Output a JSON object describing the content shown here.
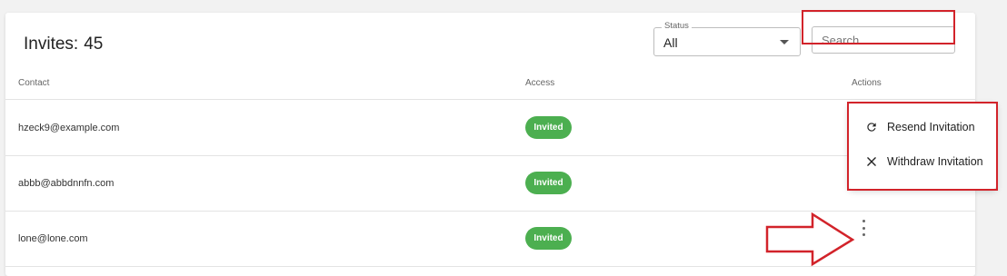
{
  "header": {
    "title": "Invites:",
    "count": "45"
  },
  "filters": {
    "status": {
      "label": "Status",
      "value": "All"
    },
    "search": {
      "placeholder": "Search"
    }
  },
  "table": {
    "columns": [
      "Contact",
      "Access",
      "Actions"
    ],
    "rows": [
      {
        "contact": "hzeck9@example.com",
        "access": "Invited"
      },
      {
        "contact": "abbb@abbdnnfn.com",
        "access": "Invited"
      },
      {
        "contact": "lone@lone.com",
        "access": "Invited"
      }
    ]
  },
  "actions_menu": {
    "items": [
      {
        "label": "Resend Invitation",
        "icon": "refresh-icon"
      },
      {
        "label": "Withdraw Invitation",
        "icon": "close-icon"
      }
    ]
  },
  "colors": {
    "badge": "#4caf50",
    "highlight": "#d2232a"
  }
}
